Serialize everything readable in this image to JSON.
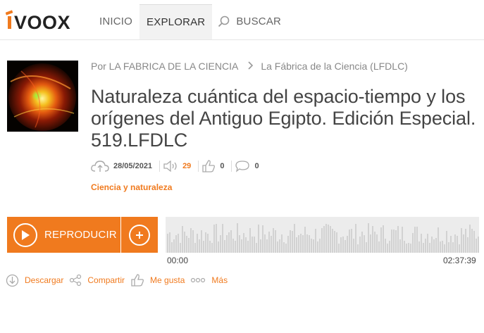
{
  "brand": {
    "logo_text": "iVOOX",
    "accent": "#f07a1e"
  },
  "nav": {
    "items": [
      "INICIO",
      "EXPLORAR"
    ],
    "search_label": "BUSCAR",
    "active": "EXPLORAR"
  },
  "episode": {
    "author_prefix": "Por LA FABRICA DE LA CIENCIA",
    "program": "La Fábrica de la Ciencia (LFDLC)",
    "title": "Naturaleza cuántica del espacio-tiempo y los orígenes del Antiguo Egipto. Edición Especial. 519.LFDLC",
    "date": "28/05/2021",
    "plays": "29",
    "likes": "0",
    "comments": "0",
    "category": "Ciencia y naturaleza"
  },
  "player": {
    "play_label": "REPRODUCIR",
    "current_time": "00:00",
    "duration": "02:37:39"
  },
  "actions": {
    "download": "Descargar",
    "share": "Compartir",
    "like": "Me gusta",
    "more": "Más"
  }
}
